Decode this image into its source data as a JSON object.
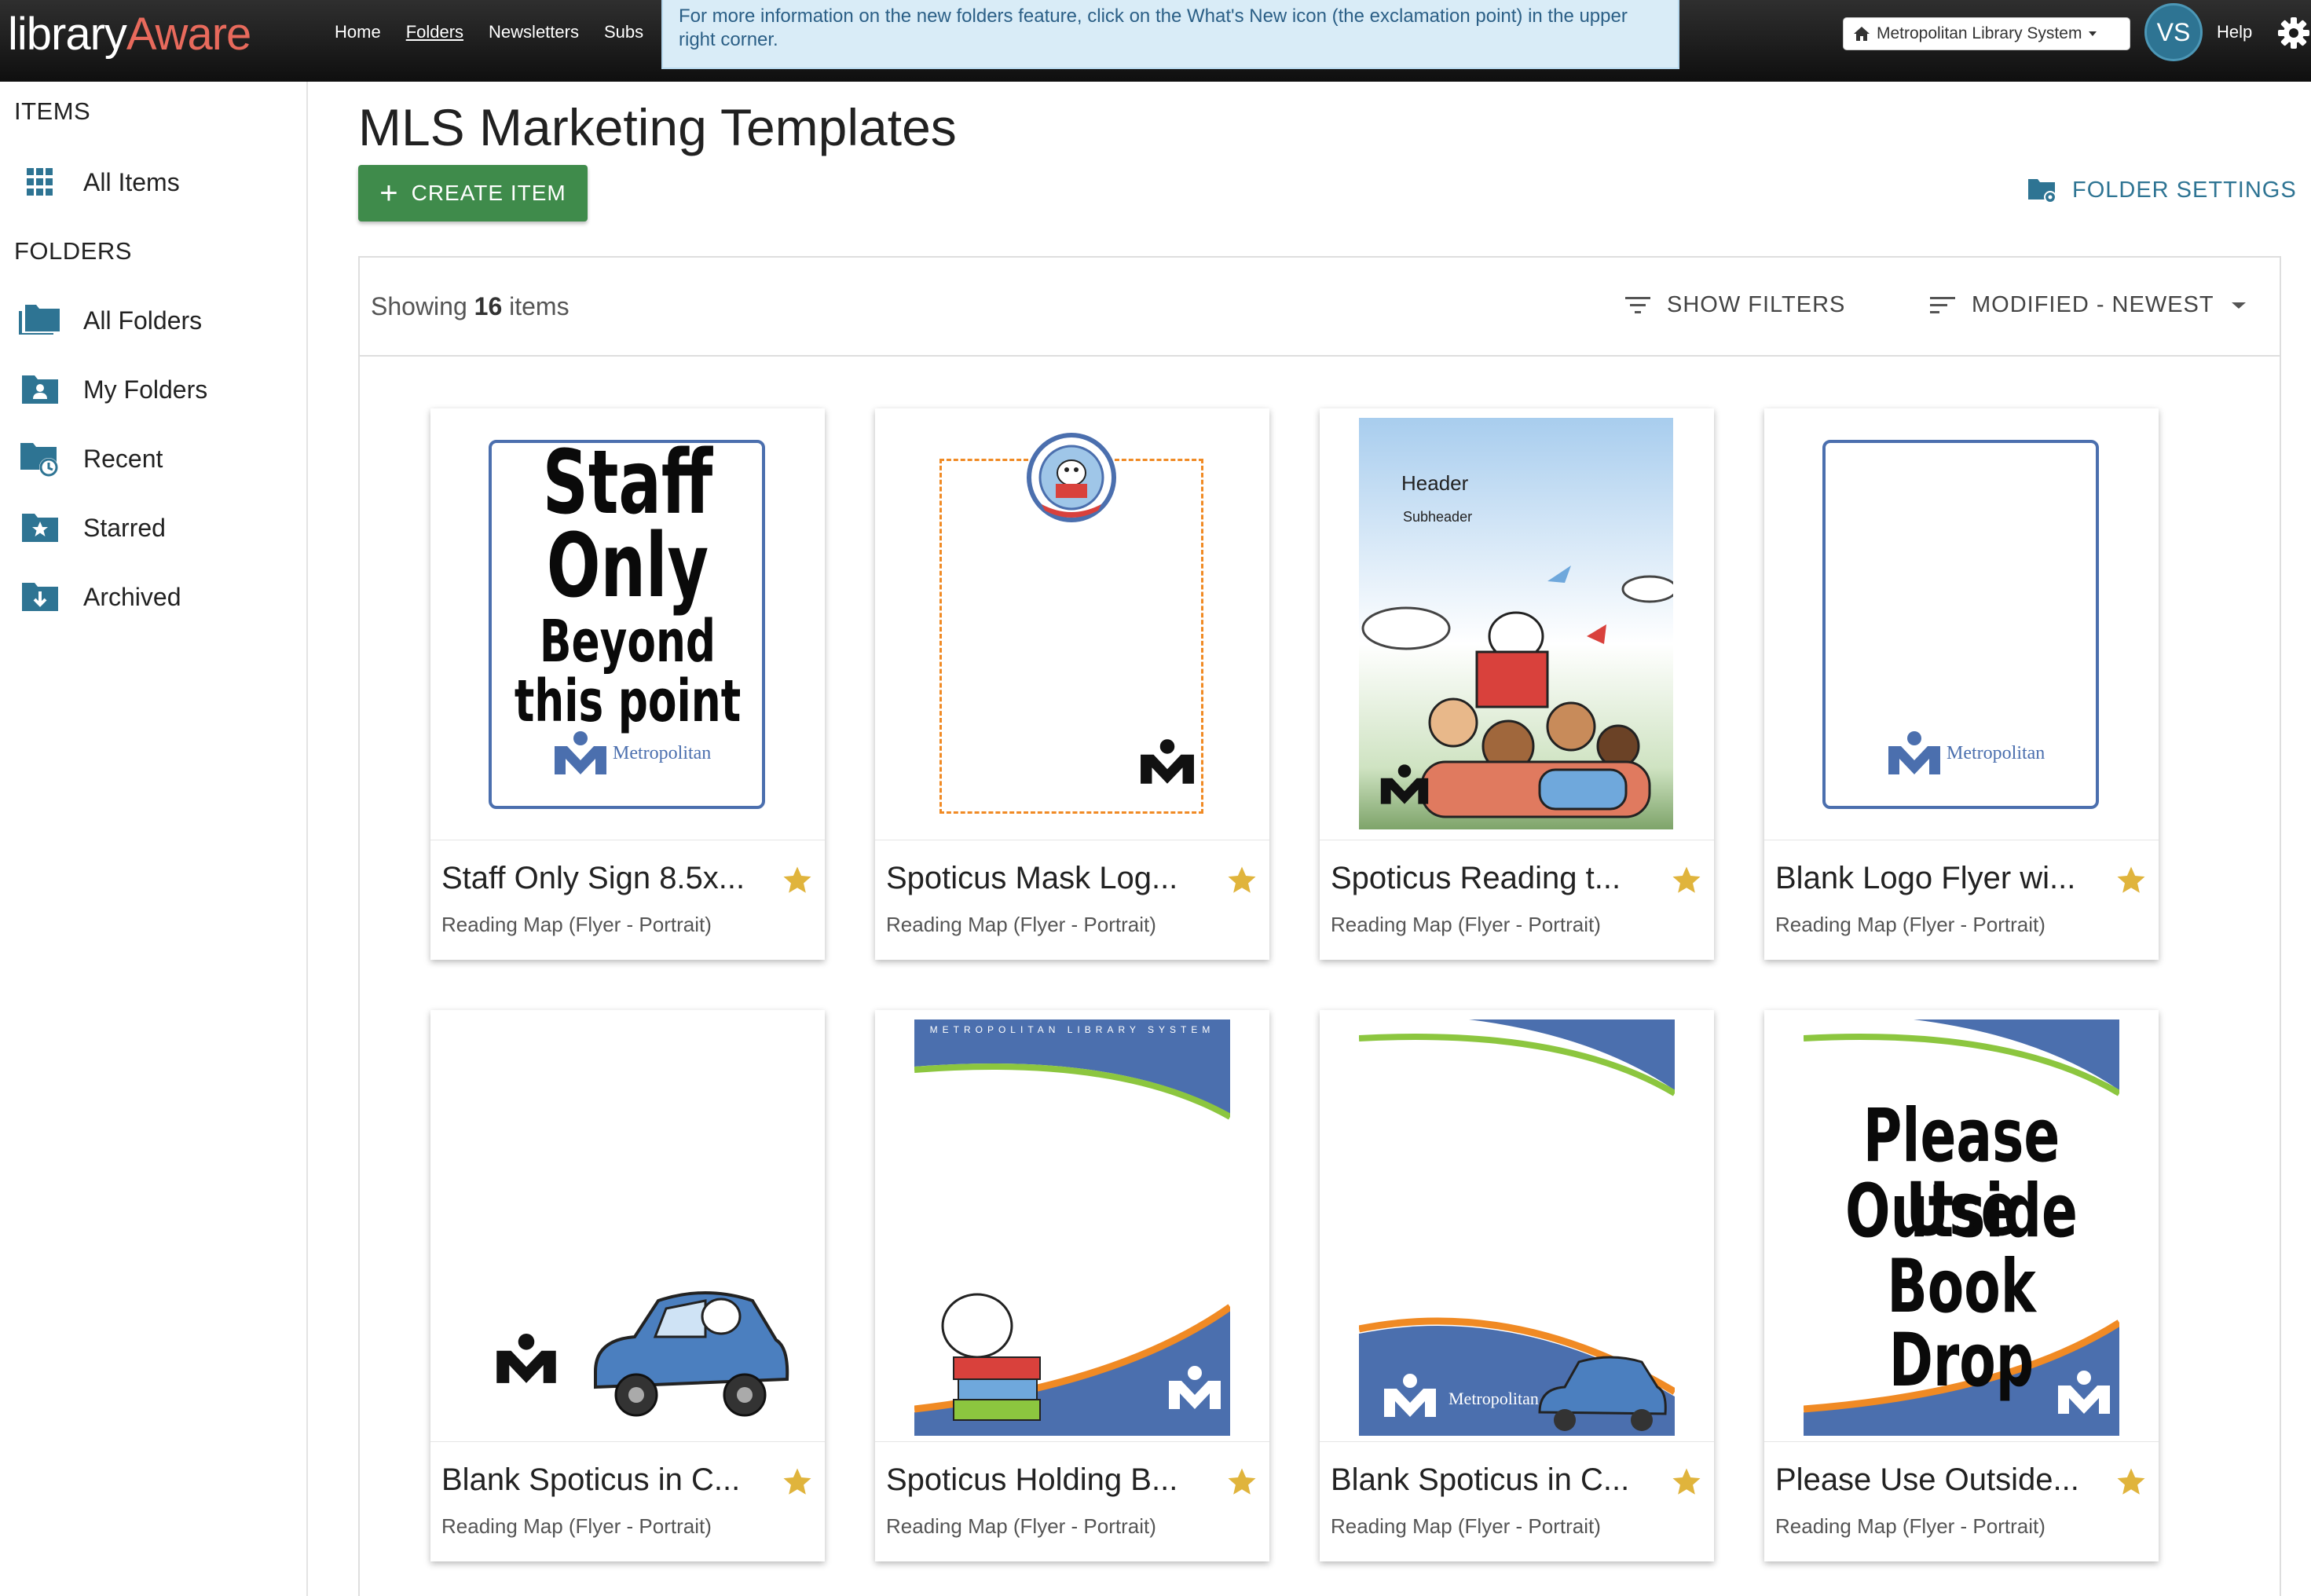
{
  "app": {
    "logo_part1": "library",
    "logo_part2": "Aware"
  },
  "nav": {
    "home": "Home",
    "folders": "Folders",
    "newsletters": "Newsletters",
    "subs": "Subs"
  },
  "notice": "For more information on the new folders feature, click on the What's New icon (the exclamation point) in the upper right corner.",
  "header": {
    "org_label": "Metropolitan Library System",
    "avatar_initials": "VS",
    "help_label": "Help"
  },
  "sidebar": {
    "items_heading": "ITEMS",
    "all_items": "All Items",
    "folders_heading": "FOLDERS",
    "folders": [
      {
        "label": "All Folders",
        "icon": "folders-icon"
      },
      {
        "label": "My Folders",
        "icon": "person-folder-icon"
      },
      {
        "label": "Recent",
        "icon": "clock-folder-icon"
      },
      {
        "label": "Starred",
        "icon": "star-folder-icon"
      },
      {
        "label": "Archived",
        "icon": "archive-folder-icon"
      }
    ]
  },
  "main": {
    "title": "MLS Marketing Templates",
    "create_label": "CREATE ITEM",
    "folder_settings_label": "FOLDER SETTINGS",
    "showing_prefix": "Showing",
    "showing_count": "16",
    "showing_suffix": "items",
    "filters_label": "SHOW FILTERS",
    "sort_label": "MODIFIED - NEWEST"
  },
  "cards": [
    {
      "title": "Staff Only Sign 8.5x...",
      "subtitle": "Reading Map (Flyer - Portrait)",
      "starred": true
    },
    {
      "title": "Spoticus Mask Log...",
      "subtitle": "Reading Map (Flyer - Portrait)",
      "starred": true
    },
    {
      "title": "Spoticus Reading t...",
      "subtitle": "Reading Map (Flyer - Portrait)",
      "starred": true
    },
    {
      "title": "Blank Logo Flyer wi...",
      "subtitle": "Reading Map (Flyer - Portrait)",
      "starred": true
    },
    {
      "title": "Blank Spoticus in C...",
      "subtitle": "Reading Map (Flyer - Portrait)",
      "starred": true
    },
    {
      "title": "Spoticus Holding B...",
      "subtitle": "Reading Map (Flyer - Portrait)",
      "starred": true
    },
    {
      "title": "Blank Spoticus in C...",
      "subtitle": "Reading Map (Flyer - Portrait)",
      "starred": true
    },
    {
      "title": "Please Use Outside...",
      "subtitle": "Reading Map (Flyer - Portrait)",
      "starred": true
    }
  ],
  "thumbs": {
    "staff_line1": "Staff",
    "staff_line2": "Only",
    "staff_line3": "Beyond",
    "staff_line4": "this point",
    "metro_word": "Metropolitan",
    "header_word": "Header",
    "subheader_word": "Subheader",
    "mls_banner": "METROPOLITAN LIBRARY SYSTEM",
    "please_line1": "Please Use",
    "please_line2": "Outside",
    "please_line3": "Book Drop"
  },
  "colors": {
    "accent_teal": "#2e7493",
    "create_green": "#3f8b4b",
    "star_gold": "#e0b43c",
    "notice_bg": "#d9ecf7",
    "logo_orange": "#e86a5c",
    "brand_blue": "#4b6fae",
    "brand_green": "#8cc63f",
    "brand_orange": "#f08a24"
  }
}
